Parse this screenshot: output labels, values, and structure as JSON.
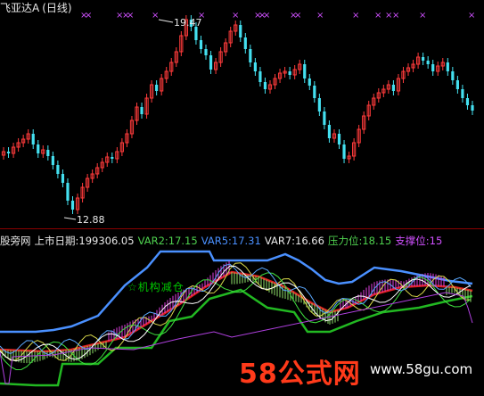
{
  "header": {
    "stock_name": "飞亚达A",
    "period": "(日线)"
  },
  "price_panel": {
    "high_label": "19.47",
    "low_label": "12.88"
  },
  "indicator_bar": {
    "source": "股旁网",
    "ipo_label": "上市日期:",
    "ipo_value": "199306.05",
    "var2_label": "VAR2:",
    "var2_value": "17.15",
    "var5_label": "VAR5:",
    "var5_value": "17.31",
    "var7_label": "VAR7:",
    "var7_value": "16.66",
    "resist_label": "压力位:",
    "resist_value": "18.15",
    "support_label": "支撑位:",
    "support_value": "15"
  },
  "annotations": {
    "buy_signal": "☆机构减仓"
  },
  "watermark": {
    "main": "58公式网",
    "url": "www.58gu.com"
  },
  "colors": {
    "up": "#ff3b3b",
    "down": "#44e0f0",
    "upper_band": "#4a90ff",
    "lower_band": "#22b822",
    "mid_line": "#e02020",
    "marker": "#d050ff"
  }
}
